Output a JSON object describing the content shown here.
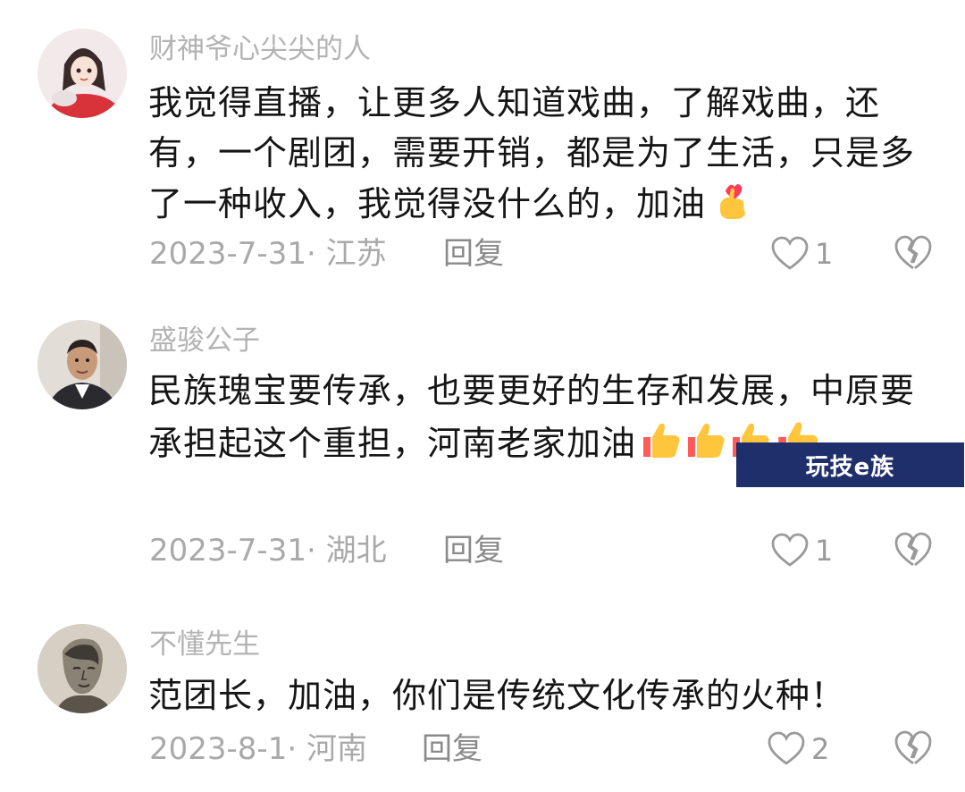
{
  "comments": [
    {
      "username": "财神爷心尖尖的人",
      "text": "我觉得直播，让更多人知道戏曲，了解戏曲，还有，一个剧团，需要开销，都是为了生活，只是多了一种收入，我觉得没什么的，加油",
      "emoji": "finger-heart-emoji",
      "date_location": "2023-7-31· 江苏",
      "reply_label": "回复",
      "likes": "1",
      "avatar": "anime-girl-avatar"
    },
    {
      "username": "盛骏公子",
      "text": "民族瑰宝要传承，也要更好的生存和发展，中原要承担起这个重担，河南老家加油",
      "emoji": "thumbs-up-emoji x4",
      "date_location": "2023-7-31· 湖北",
      "reply_label": "回复",
      "likes": "1",
      "avatar": "man-photo-avatar"
    },
    {
      "username": "不懂先生",
      "text": "范团长，加油，你们是传统文化传承的火种！",
      "date_location": "2023-8-1· 河南",
      "reply_label": "回复",
      "likes": "2",
      "avatar": "sketch-portrait-avatar"
    }
  ],
  "watermark": "玩技e族",
  "colors": {
    "username": "#b3b3b3",
    "text": "#151515",
    "meta": "#a9a9a9",
    "watermark_bg": "#1f2f6b"
  }
}
